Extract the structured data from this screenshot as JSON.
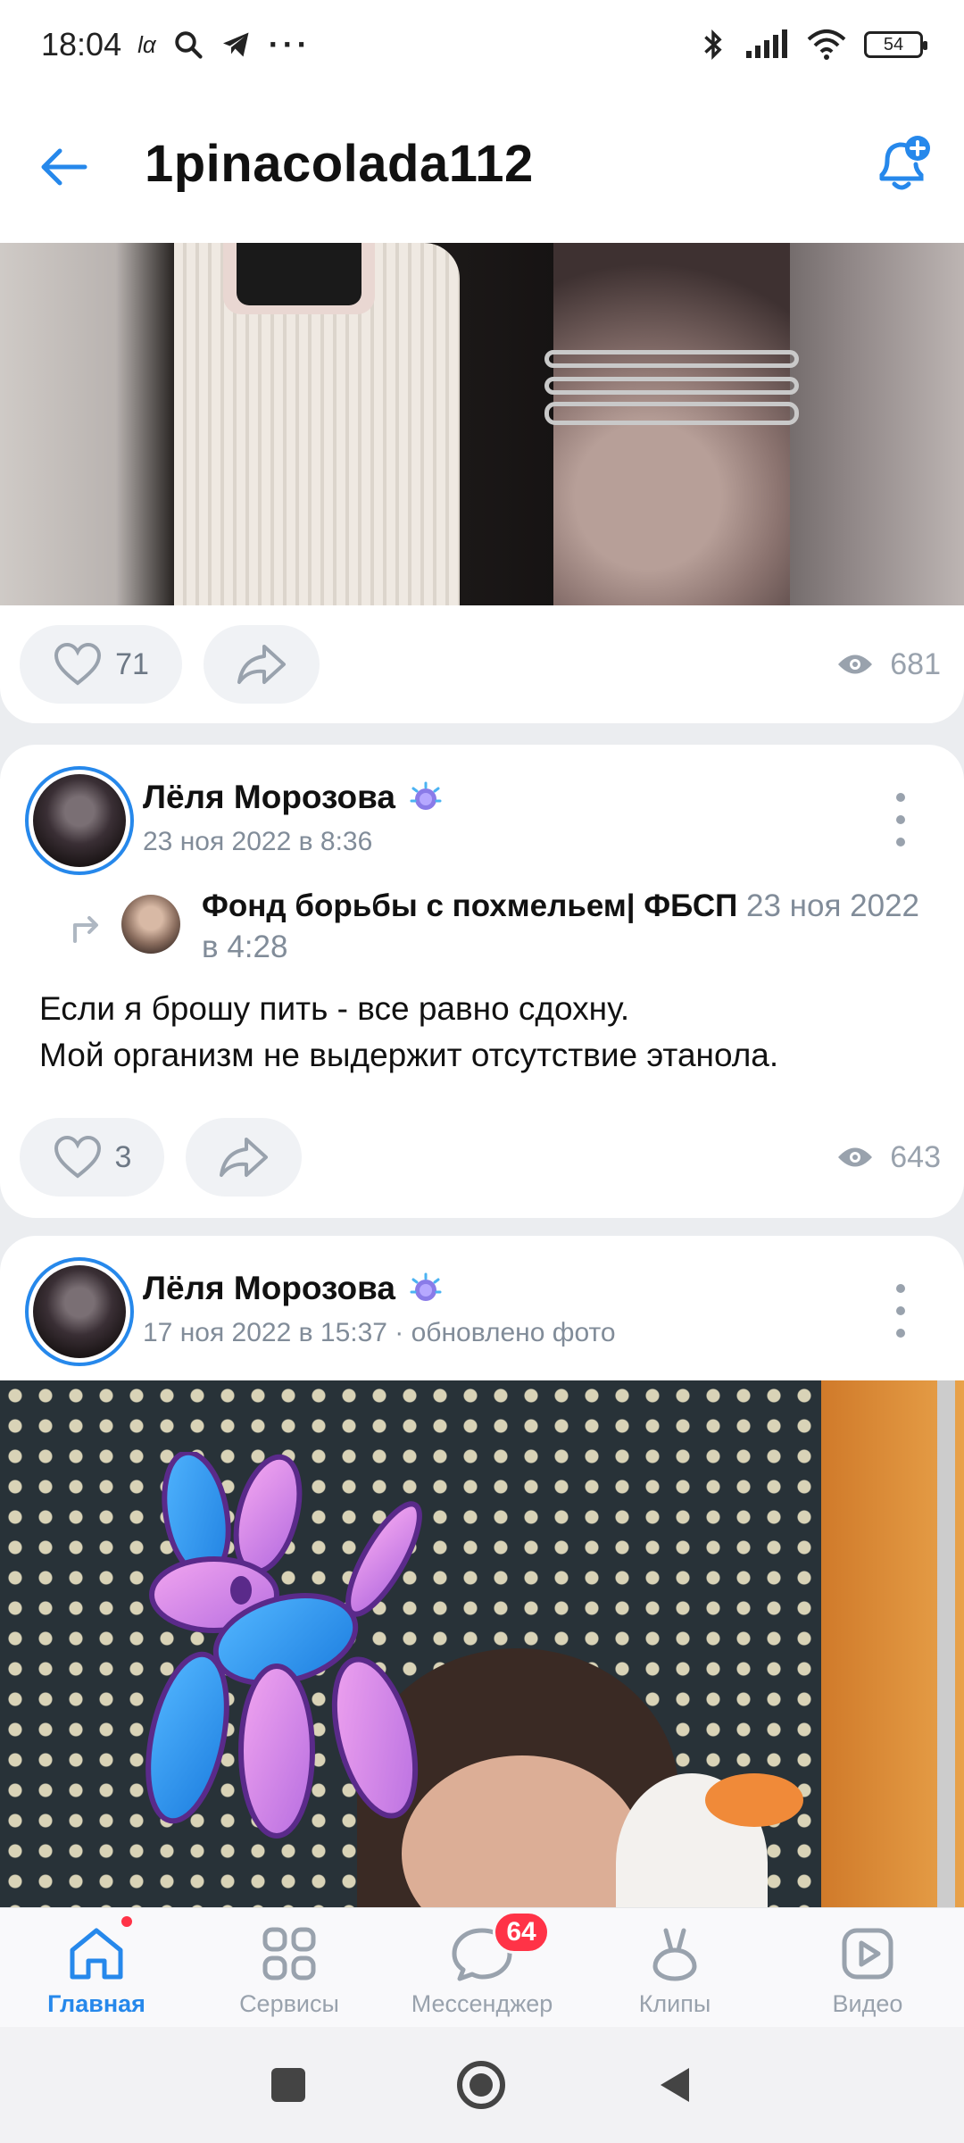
{
  "status_bar": {
    "time": "18:04",
    "small_icon_text": "lα",
    "battery": "54"
  },
  "header": {
    "title": "1pinacolada112"
  },
  "post1": {
    "likes": "71",
    "views": "681"
  },
  "post2": {
    "author": "Лёля Морозова",
    "date": "23 ноя 2022 в 8:36",
    "repost": {
      "source": "Фонд борьбы с похмельем| ФБСП",
      "date": "23 ноя 2022 в 4:28"
    },
    "text_line1": "Если я брошу пить - все равно сдохну.",
    "text_line2": "Мой организм не выдержит отсутствие этанола.",
    "likes": "3",
    "views": "643"
  },
  "post3": {
    "author": "Лёля Морозова",
    "date": "17 ноя 2022 в 15:37 · обновлено фото"
  },
  "bottom_nav": {
    "items": [
      {
        "label": "Главная"
      },
      {
        "label": "Сервисы"
      },
      {
        "label": "Мессенджер"
      },
      {
        "label": "Клипы"
      },
      {
        "label": "Видео"
      }
    ],
    "messenger_badge": "64"
  },
  "colors": {
    "accent": "#2688eb",
    "badge": "#ff3347",
    "secondary_text": "#818c99"
  },
  "icons": [
    "back-arrow-icon",
    "notifications-plus-icon",
    "heart-icon",
    "share-icon",
    "eye-icon",
    "more-vertical-icon",
    "repost-arrow-icon",
    "home-icon",
    "services-icon",
    "messenger-icon",
    "clips-icon",
    "video-icon"
  ]
}
